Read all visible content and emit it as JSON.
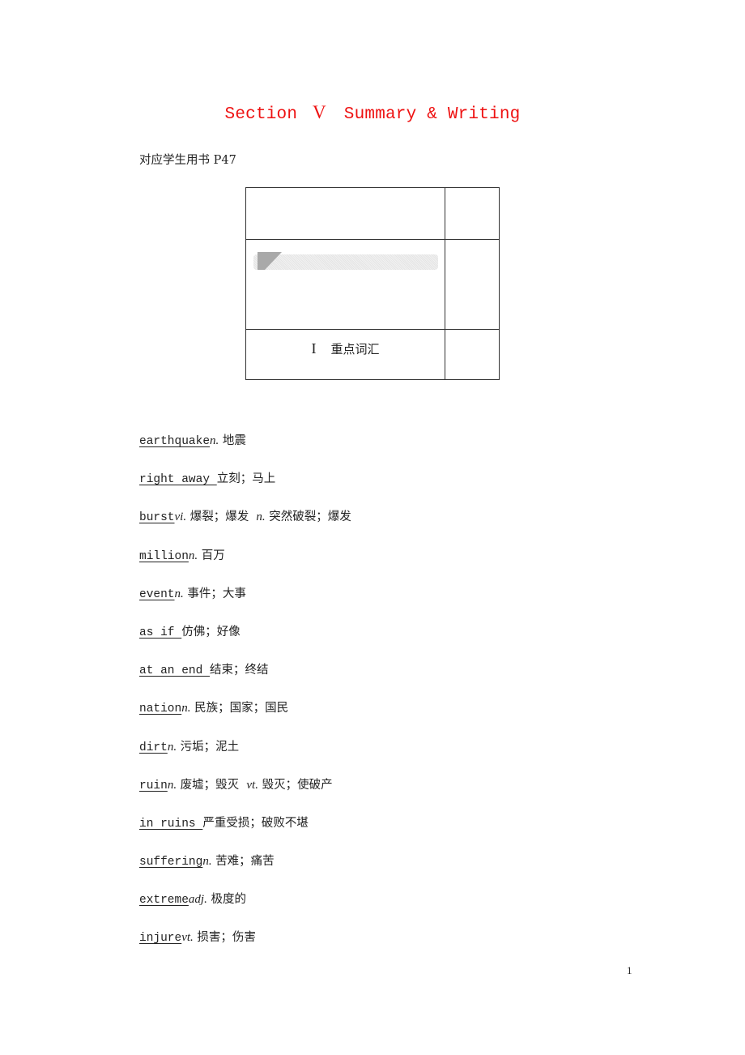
{
  "title": {
    "section": "Section",
    "roman": "V",
    "subtitle": "Summary & Writing"
  },
  "reference": "对应学生用书 P47",
  "box": {
    "section_number": "I",
    "section_label": "重点词汇"
  },
  "vocabulary": [
    {
      "term": "earthquake",
      "parts": [
        {
          "pos": "n.",
          "def": " 地震"
        }
      ]
    },
    {
      "term": "right away ",
      "parts": [
        {
          "pos": "",
          "def": "立刻；马上"
        }
      ]
    },
    {
      "term": "burst",
      "parts": [
        {
          "pos": "vi.",
          "def": " 爆裂；爆发  "
        },
        {
          "pos": "n.",
          "def": " 突然破裂；爆发"
        }
      ]
    },
    {
      "term": "million",
      "parts": [
        {
          "pos": "n.",
          "def": " 百万"
        }
      ]
    },
    {
      "term": "event",
      "parts": [
        {
          "pos": "n.",
          "def": " 事件；大事"
        }
      ]
    },
    {
      "term": "as if ",
      "parts": [
        {
          "pos": "",
          "def": "仿佛；好像"
        }
      ]
    },
    {
      "term": "at an end ",
      "parts": [
        {
          "pos": "",
          "def": "结束；终结"
        }
      ]
    },
    {
      "term": "nation",
      "parts": [
        {
          "pos": "n.",
          "def": " 民族；国家；国民"
        }
      ]
    },
    {
      "term": "dirt",
      "parts": [
        {
          "pos": "n.",
          "def": " 污垢；泥土"
        }
      ]
    },
    {
      "term": "ruin",
      "parts": [
        {
          "pos": "n.",
          "def": " 废墟；毁灭  "
        },
        {
          "pos": "vt.",
          "def": " 毁灭；使破产"
        }
      ]
    },
    {
      "term": "in ruins ",
      "parts": [
        {
          "pos": "",
          "def": "严重受损；破败不堪"
        }
      ]
    },
    {
      "term": "suffering",
      "parts": [
        {
          "pos": "n.",
          "def": " 苦难；痛苦"
        }
      ]
    },
    {
      "term": "extreme",
      "parts": [
        {
          "pos": "adj.",
          "def": " 极度的"
        }
      ]
    },
    {
      "term": "injure",
      "parts": [
        {
          "pos": "vt.",
          "def": " 损害；伤害"
        }
      ]
    }
  ],
  "page_number": "1"
}
